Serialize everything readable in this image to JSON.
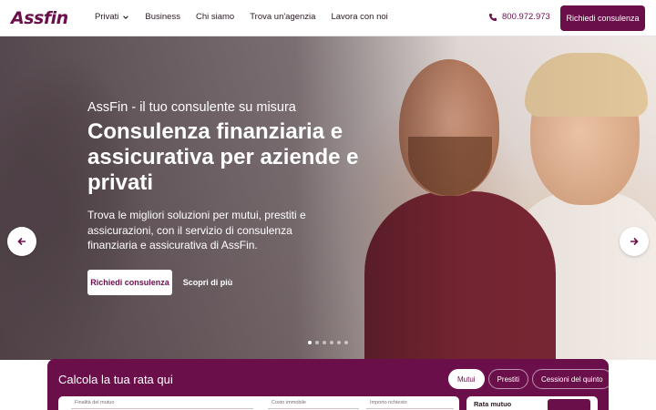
{
  "header": {
    "logo_text": "Assfin",
    "nav": [
      {
        "label": "Privati",
        "has_dropdown": true
      },
      {
        "label": "Business"
      },
      {
        "label": "Chi siamo"
      },
      {
        "label": "Trova un'agenzia"
      },
      {
        "label": "Lavora con noi"
      }
    ],
    "phone": "800.972.973",
    "cta_label": "Richiedi consulenza"
  },
  "hero": {
    "eyebrow": "AssFin - il tuo consulente su misura",
    "title": "Consulenza finanziaria e assicurativa per aziende e privati",
    "description": "Trova le migliori soluzioni per mutui, prestiti e assicurazioni, con il servizio di consulenza finanziaria e assicurativa di AssFin.",
    "primary_button": "Richiedi consulenza",
    "secondary_button": "Scopri di più",
    "slides_total": 6,
    "active_slide": 1
  },
  "calculator": {
    "title": "Calcola la tua rata qui",
    "tabs": [
      {
        "label": "Mutui",
        "active": true
      },
      {
        "label": "Prestiti",
        "active": false
      },
      {
        "label": "Cessioni del quinto",
        "active": false
      }
    ],
    "fields": [
      {
        "label": "Finalità del mutuo"
      },
      {
        "label": "Costo immobile"
      },
      {
        "label": "Importo richiesto"
      }
    ],
    "result_label": "Rata mutuo"
  },
  "colors": {
    "brand": "#6b0f4a",
    "white": "#ffffff"
  }
}
